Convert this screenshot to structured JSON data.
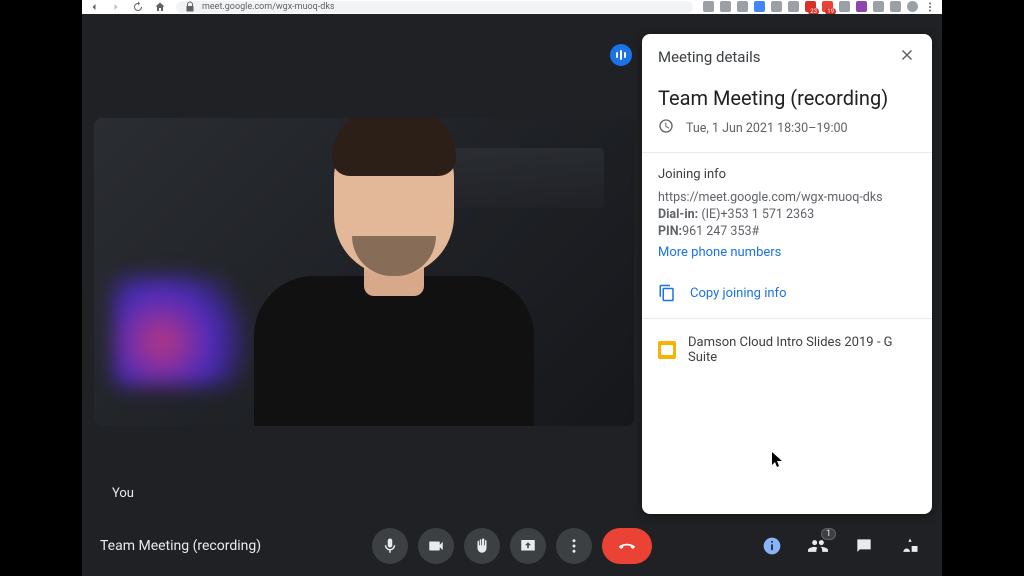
{
  "browser": {
    "url": "meet.google.com/wgx-muoq-dks",
    "extension_badges": [
      "23",
      "19"
    ]
  },
  "meet": {
    "self_label": "You",
    "meeting_title": "Team Meeting (recording)",
    "participant_count": "1"
  },
  "panel": {
    "header": "Meeting details",
    "title": "Team Meeting (recording)",
    "time": "Tue, 1 Jun 2021 18:30–19:00",
    "joining_label": "Joining info",
    "join_url": "https://meet.google.com/wgx-muoq-dks",
    "dial_label": "Dial-in:",
    "dial_value": "(IE)+353 1 571 2363",
    "pin_label": "PIN:",
    "pin_value": "961 247 353#",
    "more_numbers": "More phone numbers",
    "copy_label": "Copy joining info",
    "attachment": "Damson Cloud Intro Slides 2019 - G Suite"
  }
}
